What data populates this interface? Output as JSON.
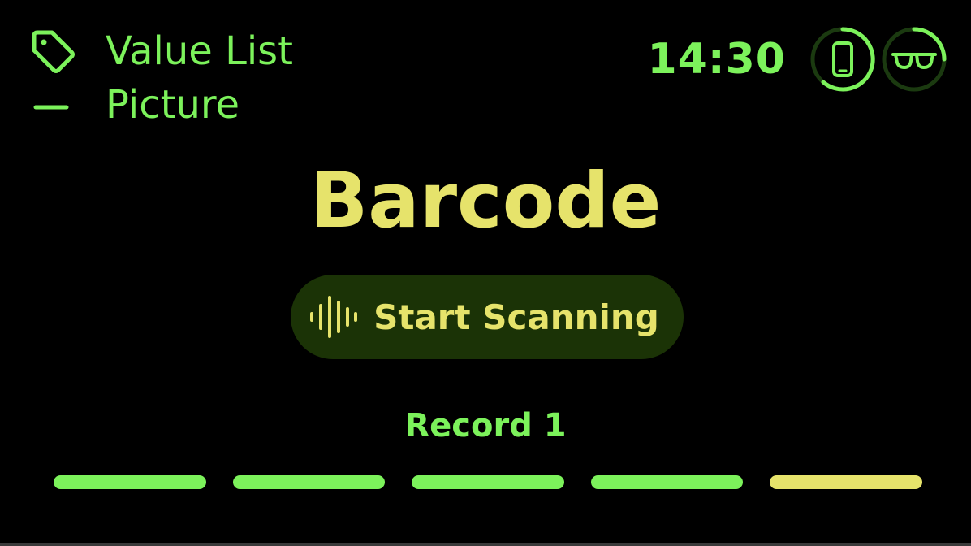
{
  "breadcrumb": {
    "items": [
      {
        "icon": "tag-icon",
        "label": "Value List"
      },
      {
        "icon": "dash-icon",
        "label": "Picture"
      }
    ]
  },
  "status_bar": {
    "time": "14:30",
    "icons": [
      "phone-icon",
      "glasses-icon"
    ]
  },
  "main": {
    "title": "Barcode",
    "scan_button": {
      "icon": "barcode-scan-icon",
      "label": "Start Scanning"
    },
    "record_label": "Record 1"
  },
  "progress": {
    "total_steps": 5,
    "current_step": 5
  },
  "colors": {
    "background": "#000000",
    "green": "#7cf25b",
    "yellow": "#e6e36b",
    "button_bg": "#1b3306"
  }
}
